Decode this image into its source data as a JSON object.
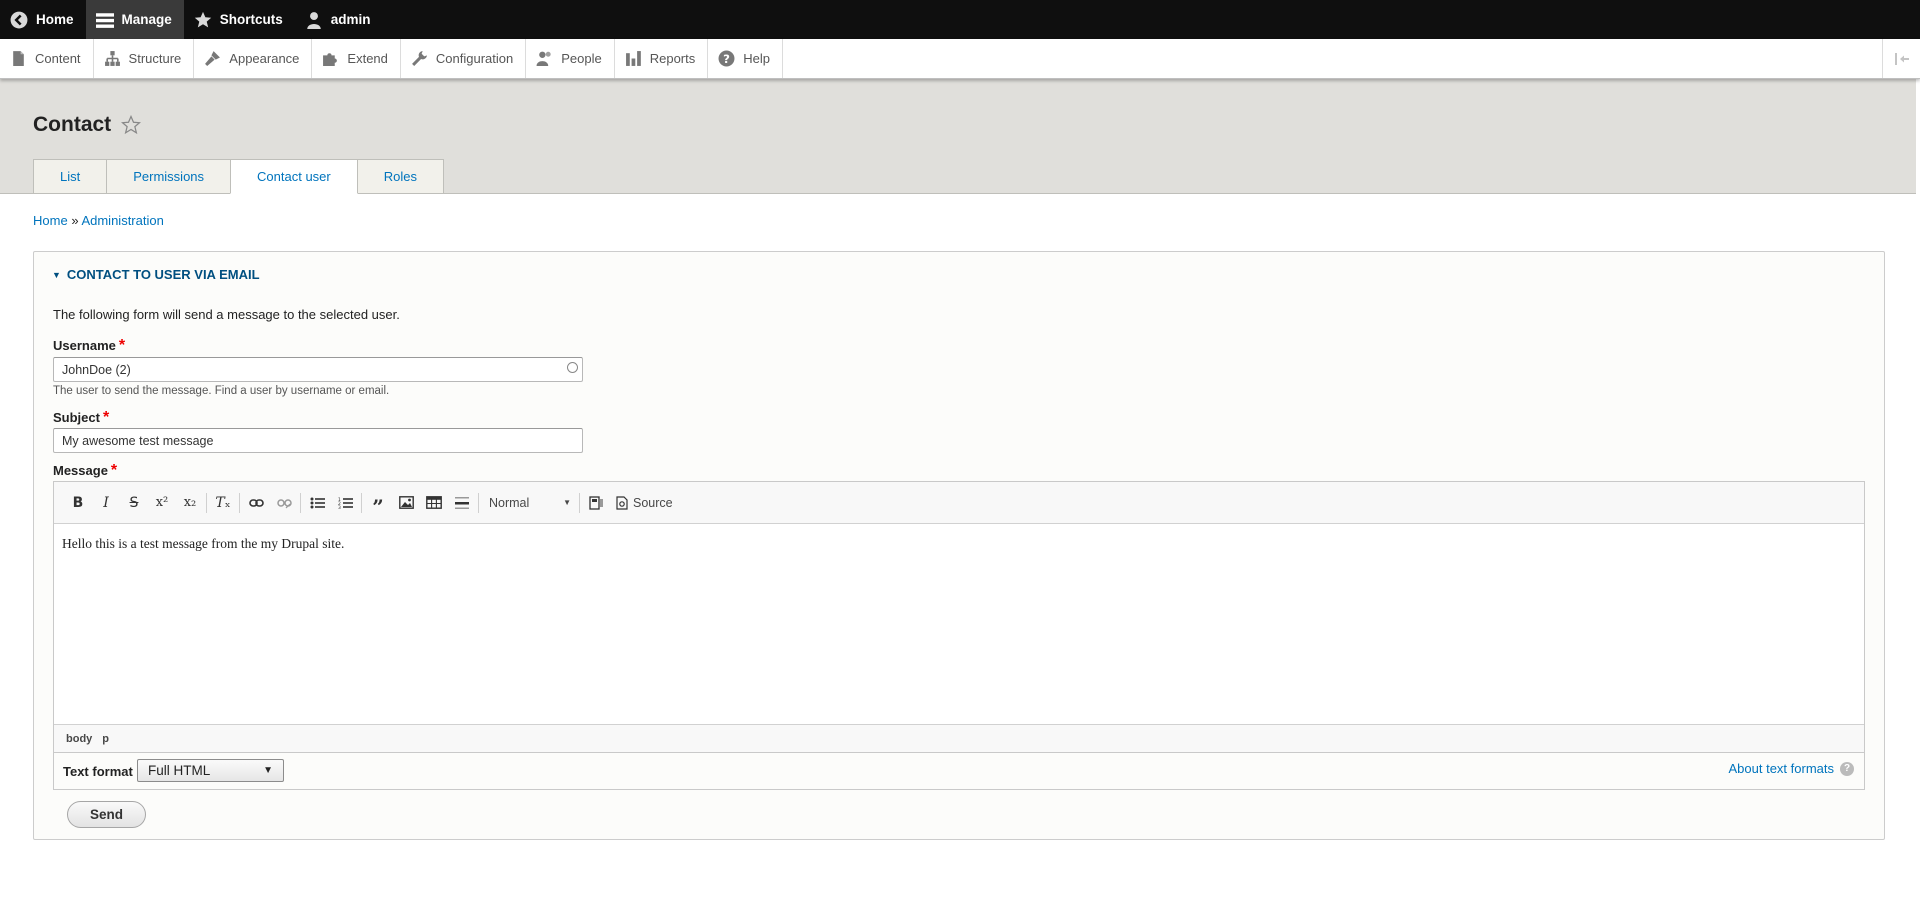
{
  "toolbar": {
    "items": [
      {
        "label": "Home",
        "icon": "chevron-left-circle-icon"
      },
      {
        "label": "Manage",
        "icon": "hamburger-icon"
      },
      {
        "label": "Shortcuts",
        "icon": "star-icon"
      },
      {
        "label": "admin",
        "icon": "user-icon"
      }
    ]
  },
  "tray": {
    "items": [
      {
        "label": "Content",
        "icon": "document-icon"
      },
      {
        "label": "Structure",
        "icon": "structure-icon"
      },
      {
        "label": "Appearance",
        "icon": "paintbrush-icon"
      },
      {
        "label": "Extend",
        "icon": "puzzle-icon"
      },
      {
        "label": "Configuration",
        "icon": "wrench-icon"
      },
      {
        "label": "People",
        "icon": "people-icon"
      },
      {
        "label": "Reports",
        "icon": "bar-chart-icon"
      },
      {
        "label": "Help",
        "icon": "help-icon"
      }
    ]
  },
  "page": {
    "title": "Contact",
    "tabs": [
      {
        "label": "List",
        "active": false
      },
      {
        "label": "Permissions",
        "active": false
      },
      {
        "label": "Contact user",
        "active": true
      },
      {
        "label": "Roles",
        "active": false
      }
    ],
    "breadcrumb": {
      "home": "Home",
      "separator": "»",
      "admin": "Administration"
    }
  },
  "form": {
    "legend": "CONTACT TO USER VIA EMAIL",
    "intro": "The following form will send a message to the selected user.",
    "username": {
      "label": "Username",
      "required": "*",
      "value": "JohnDoe (2)",
      "help": "The user to send the message. Find a user by username or email."
    },
    "subject": {
      "label": "Subject",
      "required": "*",
      "value": "My awesome test message"
    },
    "message": {
      "label": "Message",
      "required": "*",
      "format_dropdown": "Normal",
      "source_label": "Source",
      "body": "Hello this is a test message from the my Drupal site.",
      "path": [
        "body",
        "p"
      ]
    },
    "text_format": {
      "label": "Text format",
      "value": "Full HTML",
      "about": "About text formats"
    },
    "send_label": "Send"
  },
  "colors": {
    "link": "#0074bd",
    "header_bg": "#e0dfdb",
    "toolbar_bg": "#0f0f0f",
    "required": "#ee0000"
  }
}
